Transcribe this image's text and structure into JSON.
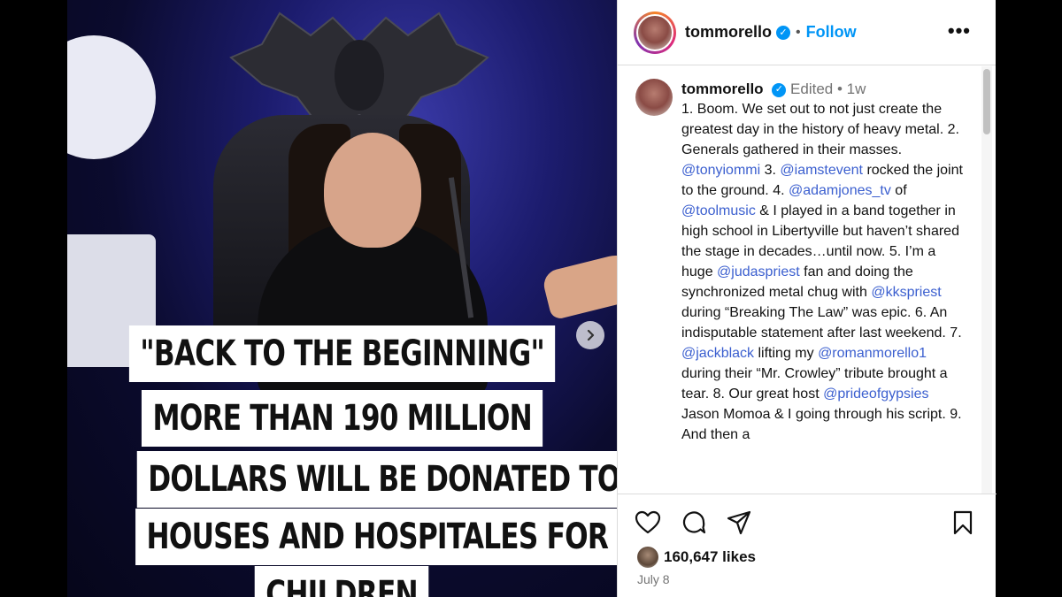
{
  "media": {
    "caption_lines": [
      "\"BACK TO THE BEGINNING\"",
      "MORE THAN 190 MILLION",
      "DOLLARS WILL BE DONATED TO",
      "HOUSES AND HOSPITALES FOR",
      "CHILDREN"
    ],
    "next_icon": "chevron-right-icon"
  },
  "header": {
    "username": "tommorello",
    "separator": "•",
    "follow_label": "Follow",
    "more_label": "•••"
  },
  "caption": {
    "username": "tommorello",
    "edited": "Edited",
    "separator": "•",
    "age": "1w",
    "segments": [
      {
        "t": "1. Boom. We set out to not just create the greatest day in the history of heavy metal. 2. Generals gathered in their masses. "
      },
      {
        "m": "@tonyiommi"
      },
      {
        "t": " 3. "
      },
      {
        "m": "@iamstevent"
      },
      {
        "t": " rocked the joint to the ground. 4. "
      },
      {
        "m": "@adamjones_tv"
      },
      {
        "t": " of "
      },
      {
        "m": "@toolmusic"
      },
      {
        "t": " & I played in a band together in high school in Libertyville but haven’t shared the stage in decades…until now. 5. I’m a huge "
      },
      {
        "m": "@judaspriest"
      },
      {
        "t": " fan and doing the synchronized metal chug with "
      },
      {
        "m": "@kkspriest"
      },
      {
        "t": " during “Breaking The Law” was epic. 6. An indisputable statement after last weekend. 7. "
      },
      {
        "m": "@jackblack"
      },
      {
        "t": " lifting my "
      },
      {
        "m": "@romanmorello1"
      },
      {
        "t": " during their “Mr. Crowley” tribute brought a tear. 8. Our great host "
      },
      {
        "m": "@prideofgypsies"
      },
      {
        "t": " Jason Momoa & I going through his script. 9. And then a"
      }
    ]
  },
  "actions": {
    "likes": "160,647 likes",
    "date": "July 8"
  },
  "colors": {
    "accent": "#0095f6",
    "mention": "#3b5fcf",
    "muted": "#737373"
  }
}
